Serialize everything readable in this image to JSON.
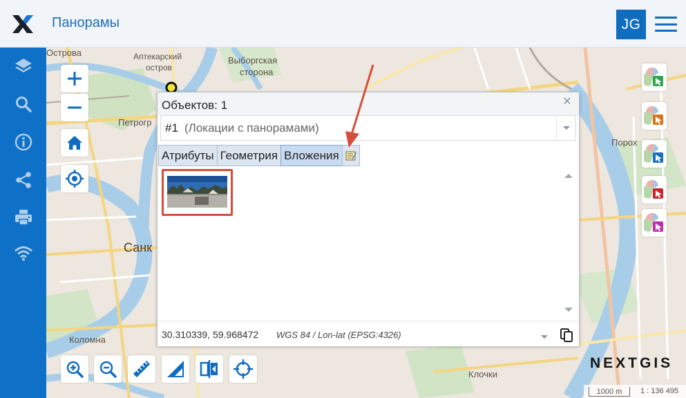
{
  "header": {
    "title": "Панорамы",
    "avatar_initials": "JG",
    "brand_color": "#0f6cbf"
  },
  "sidebar": {
    "items": [
      {
        "icon": "layers-icon"
      },
      {
        "icon": "search-icon"
      },
      {
        "icon": "info-icon"
      },
      {
        "icon": "share-icon"
      },
      {
        "icon": "print-icon"
      },
      {
        "icon": "wifi-icon"
      }
    ]
  },
  "map": {
    "labels": {
      "ostrova": "Острова",
      "aptekarsky": "Аптекарский",
      "ostrov": "остров",
      "vyborgskaya": "Выборгская",
      "storona": "сторона",
      "petrogr": "Петрогр",
      "sank": "Санк",
      "porokh": "Порох",
      "kolomna": "Коломна",
      "klochki": "Клочки"
    },
    "brand": "NEXTGIS",
    "scale_bar": "1000 m",
    "scale_ratio": "1 : 136 495"
  },
  "popup": {
    "title": "Объектов: 1",
    "feature_id": "#1",
    "feature_layer": "(Локации с панорамами)",
    "tabs": [
      "Атрибуты",
      "Геометрия",
      "Вложения"
    ],
    "active_tab": "Вложения",
    "coords": "30.310339, 59.968472",
    "crs": "WGS 84 / Lon-lat (EPSG:4326)"
  },
  "colors": {
    "annotation_red": "#d44e3c",
    "tab_active": "#c9dbf0"
  }
}
